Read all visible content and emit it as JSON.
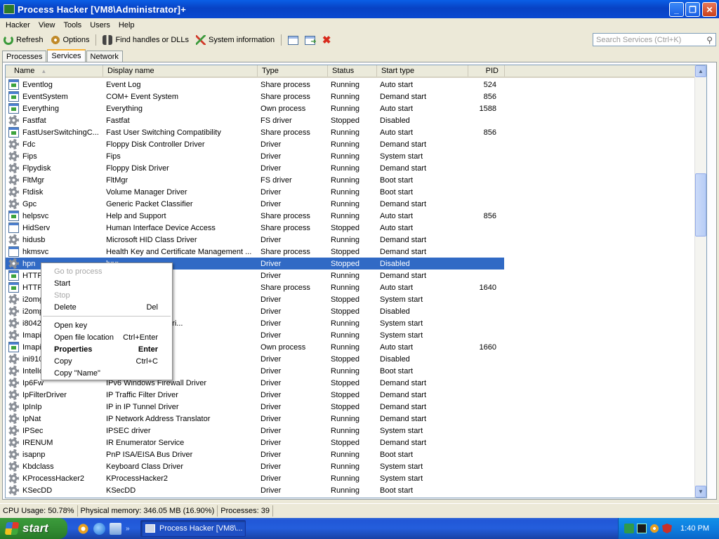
{
  "window": {
    "title": "Process Hacker [VM8\\Administrator]+"
  },
  "menu": [
    "Hacker",
    "View",
    "Tools",
    "Users",
    "Help"
  ],
  "toolbar": {
    "refresh": "Refresh",
    "options": "Options",
    "find": "Find handles or DLLs",
    "sysinfo": "System information"
  },
  "search": {
    "placeholder": "Search Services (Ctrl+K)"
  },
  "tabs": [
    "Processes",
    "Services",
    "Network"
  ],
  "columns": [
    "Name",
    "Display name",
    "Type",
    "Status",
    "Start type",
    "PID"
  ],
  "rows": [
    {
      "icon": "win",
      "name": "Eventlog",
      "display": "Event Log",
      "type": "Share process",
      "status": "Running",
      "start": "Auto start",
      "pid": "524"
    },
    {
      "icon": "win",
      "name": "EventSystem",
      "display": "COM+ Event System",
      "type": "Share process",
      "status": "Running",
      "start": "Demand start",
      "pid": "856"
    },
    {
      "icon": "win",
      "name": "Everything",
      "display": "Everything",
      "type": "Own process",
      "status": "Running",
      "start": "Auto start",
      "pid": "1588"
    },
    {
      "icon": "gear",
      "name": "Fastfat",
      "display": "Fastfat",
      "type": "FS driver",
      "status": "Stopped",
      "start": "Disabled",
      "pid": ""
    },
    {
      "icon": "win",
      "name": "FastUserSwitchingC...",
      "display": "Fast User Switching Compatibility",
      "type": "Share process",
      "status": "Running",
      "start": "Auto start",
      "pid": "856"
    },
    {
      "icon": "gear",
      "name": "Fdc",
      "display": "Floppy Disk Controller Driver",
      "type": "Driver",
      "status": "Running",
      "start": "Demand start",
      "pid": ""
    },
    {
      "icon": "gear",
      "name": "Fips",
      "display": "Fips",
      "type": "Driver",
      "status": "Running",
      "start": "System start",
      "pid": ""
    },
    {
      "icon": "gear",
      "name": "Flpydisk",
      "display": "Floppy Disk Driver",
      "type": "Driver",
      "status": "Running",
      "start": "Demand start",
      "pid": ""
    },
    {
      "icon": "gear",
      "name": "FltMgr",
      "display": "FltMgr",
      "type": "FS driver",
      "status": "Running",
      "start": "Boot start",
      "pid": ""
    },
    {
      "icon": "gear",
      "name": "Ftdisk",
      "display": "Volume Manager Driver",
      "type": "Driver",
      "status": "Running",
      "start": "Boot start",
      "pid": ""
    },
    {
      "icon": "gear",
      "name": "Gpc",
      "display": "Generic Packet Classifier",
      "type": "Driver",
      "status": "Running",
      "start": "Demand start",
      "pid": ""
    },
    {
      "icon": "win",
      "name": "helpsvc",
      "display": "Help and Support",
      "type": "Share process",
      "status": "Running",
      "start": "Auto start",
      "pid": "856"
    },
    {
      "icon": "blank",
      "name": "HidServ",
      "display": "Human Interface Device Access",
      "type": "Share process",
      "status": "Stopped",
      "start": "Auto start",
      "pid": ""
    },
    {
      "icon": "gear",
      "name": "hidusb",
      "display": "Microsoft HID Class Driver",
      "type": "Driver",
      "status": "Running",
      "start": "Demand start",
      "pid": ""
    },
    {
      "icon": "blank",
      "name": "hkmsvc",
      "display": "Health Key and Certificate Management ...",
      "type": "Share process",
      "status": "Stopped",
      "start": "Demand start",
      "pid": ""
    },
    {
      "icon": "gear",
      "name": "hpn",
      "display": "hpn",
      "type": "Driver",
      "status": "Stopped",
      "start": "Disabled",
      "pid": "",
      "selected": true
    },
    {
      "icon": "win",
      "name": "HTTP",
      "display": "",
      "type": "Driver",
      "status": "Running",
      "start": "Demand start",
      "pid": ""
    },
    {
      "icon": "win",
      "name": "HTTPFilter",
      "display": "",
      "type": "Share process",
      "status": "Running",
      "start": "Auto start",
      "pid": "1640"
    },
    {
      "icon": "gear",
      "name": "i2omgmt",
      "display": "",
      "type": "Driver",
      "status": "Stopped",
      "start": "System start",
      "pid": ""
    },
    {
      "icon": "gear",
      "name": "i2omp",
      "display": "",
      "type": "Driver",
      "status": "Stopped",
      "start": "Disabled",
      "pid": ""
    },
    {
      "icon": "gear",
      "name": "i8042prt",
      "display": "PS/2 Mouse Port Dri...",
      "type": "Driver",
      "status": "Running",
      "start": "System start",
      "pid": ""
    },
    {
      "icon": "gear",
      "name": "Imapi",
      "display": "ver",
      "type": "Driver",
      "status": "Running",
      "start": "System start",
      "pid": ""
    },
    {
      "icon": "win",
      "name": "ImapiService",
      "display": "OM Service",
      "type": "Own process",
      "status": "Running",
      "start": "Auto start",
      "pid": "1660"
    },
    {
      "icon": "gear",
      "name": "ini910u",
      "display": "",
      "type": "Driver",
      "status": "Stopped",
      "start": "Disabled",
      "pid": ""
    },
    {
      "icon": "gear",
      "name": "IntelIde",
      "display": "",
      "type": "Driver",
      "status": "Running",
      "start": "Boot start",
      "pid": ""
    },
    {
      "icon": "gear",
      "name": "Ip6Fw",
      "display": "IPv6 Windows Firewall Driver",
      "type": "Driver",
      "status": "Stopped",
      "start": "Demand start",
      "pid": ""
    },
    {
      "icon": "gear",
      "name": "IpFilterDriver",
      "display": "IP Traffic Filter Driver",
      "type": "Driver",
      "status": "Stopped",
      "start": "Demand start",
      "pid": ""
    },
    {
      "icon": "gear",
      "name": "IpInIp",
      "display": "IP in IP Tunnel Driver",
      "type": "Driver",
      "status": "Stopped",
      "start": "Demand start",
      "pid": ""
    },
    {
      "icon": "gear",
      "name": "IpNat",
      "display": "IP Network Address Translator",
      "type": "Driver",
      "status": "Running",
      "start": "Demand start",
      "pid": ""
    },
    {
      "icon": "gear",
      "name": "IPSec",
      "display": "IPSEC driver",
      "type": "Driver",
      "status": "Running",
      "start": "System start",
      "pid": ""
    },
    {
      "icon": "gear",
      "name": "IRENUM",
      "display": "IR Enumerator Service",
      "type": "Driver",
      "status": "Stopped",
      "start": "Demand start",
      "pid": ""
    },
    {
      "icon": "gear",
      "name": "isapnp",
      "display": "PnP ISA/EISA Bus Driver",
      "type": "Driver",
      "status": "Running",
      "start": "Boot start",
      "pid": ""
    },
    {
      "icon": "gear",
      "name": "Kbdclass",
      "display": "Keyboard Class Driver",
      "type": "Driver",
      "status": "Running",
      "start": "System start",
      "pid": ""
    },
    {
      "icon": "gear",
      "name": "KProcessHacker2",
      "display": "KProcessHacker2",
      "type": "Driver",
      "status": "Running",
      "start": "System start",
      "pid": ""
    },
    {
      "icon": "gear",
      "name": "KSecDD",
      "display": "KSecDD",
      "type": "Driver",
      "status": "Running",
      "start": "Boot start",
      "pid": ""
    }
  ],
  "context_menu": [
    {
      "label": "Go to process",
      "shortcut": "",
      "disabled": true
    },
    {
      "label": "Start",
      "shortcut": ""
    },
    {
      "label": "Stop",
      "shortcut": "",
      "disabled": true
    },
    {
      "label": "Delete",
      "shortcut": "Del"
    },
    {
      "sep": true
    },
    {
      "label": "Open key",
      "shortcut": ""
    },
    {
      "label": "Open file location",
      "shortcut": "Ctrl+Enter"
    },
    {
      "label": "Properties",
      "shortcut": "Enter",
      "bold": true
    },
    {
      "label": "Copy",
      "shortcut": "Ctrl+C"
    },
    {
      "label": "Copy \"Name\"",
      "shortcut": ""
    }
  ],
  "status": {
    "cpu": "CPU Usage: 50.78%",
    "memory": "Physical memory: 346.05 MB (16.90%)",
    "processes": "Processes: 39"
  },
  "taskbar": {
    "start": "start",
    "item": "Process Hacker [VM8\\...",
    "clock": "1:40 PM"
  }
}
